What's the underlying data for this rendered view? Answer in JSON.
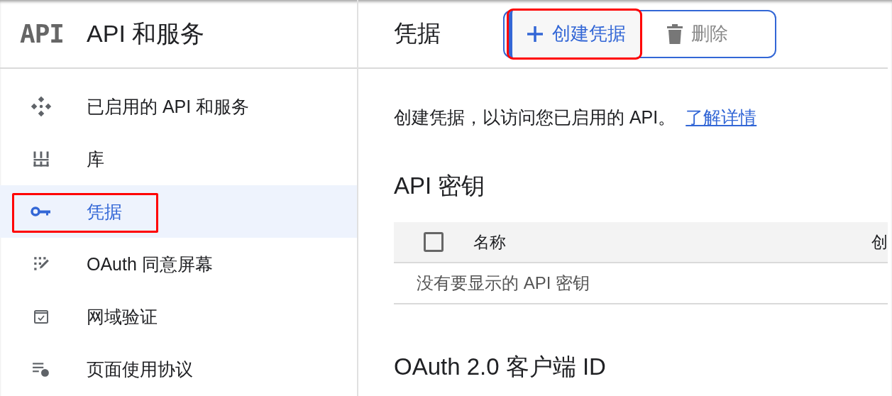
{
  "sidebar": {
    "logo": "API",
    "title": "API 和服务",
    "items": [
      {
        "label": "已启用的 API 和服务",
        "kind": "apis",
        "selected": false
      },
      {
        "label": "库",
        "kind": "library",
        "selected": false
      },
      {
        "label": "凭据",
        "kind": "key",
        "selected": true
      },
      {
        "label": "OAuth 同意屏幕",
        "kind": "consent",
        "selected": false
      },
      {
        "label": "网域验证",
        "kind": "domain",
        "selected": false
      },
      {
        "label": "页面使用协议",
        "kind": "agreement",
        "selected": false
      }
    ]
  },
  "header": {
    "title": "凭据",
    "buttons": [
      {
        "label": "创建凭据",
        "kind": "create",
        "disabled": false
      },
      {
        "label": "删除",
        "kind": "delete",
        "disabled": true
      }
    ]
  },
  "intro": {
    "text": "创建凭据，以访问您已启用的 API。",
    "link": "了解详情"
  },
  "api_keys": {
    "title": "API 密钥",
    "select_all_checked": false,
    "columns": [
      "名称",
      "创"
    ],
    "empty_message": "没有要显示的 API 密钥"
  },
  "oauth": {
    "title": "OAuth 2.0 客户端 ID"
  }
}
